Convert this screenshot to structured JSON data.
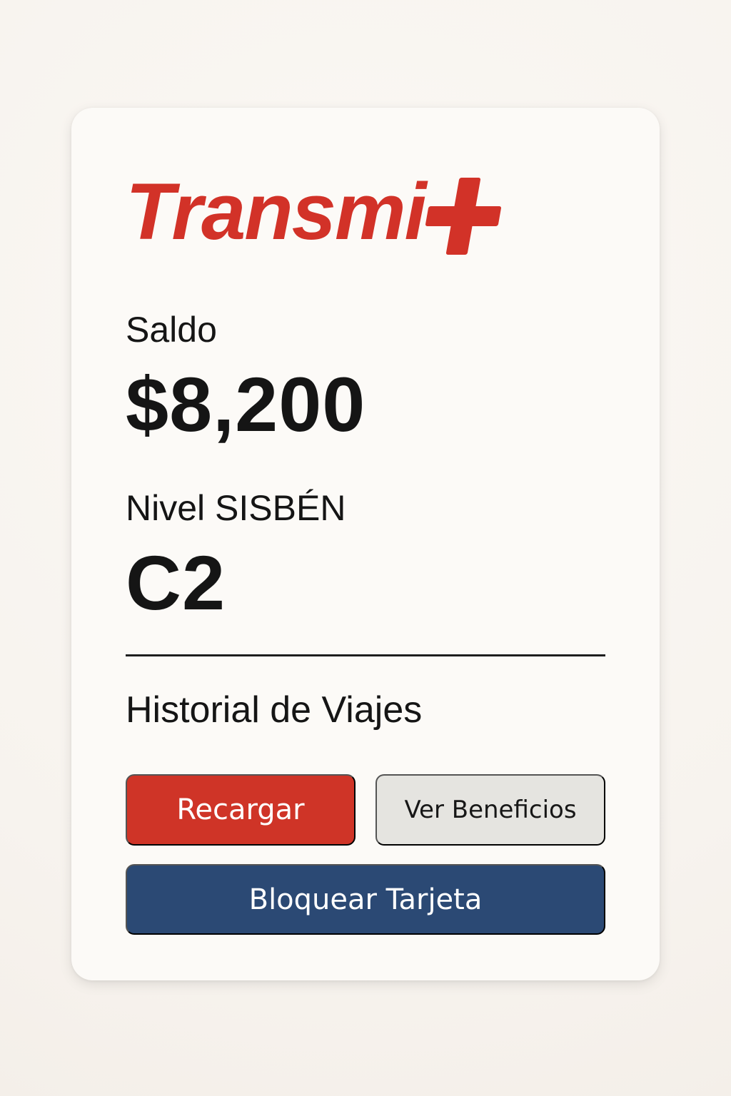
{
  "brand": {
    "text": "Transmi",
    "logo_color": "#d23228"
  },
  "balance": {
    "label": "Saldo",
    "value": "$8,200"
  },
  "sisben": {
    "label": "Nivel SISBÉN",
    "value": "C2"
  },
  "history": {
    "label": "Historial de Viajes"
  },
  "actions": {
    "recharge": "Recargar",
    "benefits": "Ver Beneficios",
    "block_card": "Bloquear Tarjeta"
  },
  "colors": {
    "accent_red": "#cf3427",
    "secondary_gray": "#e5e4e0",
    "navy": "#2b4974",
    "text": "#151515"
  }
}
